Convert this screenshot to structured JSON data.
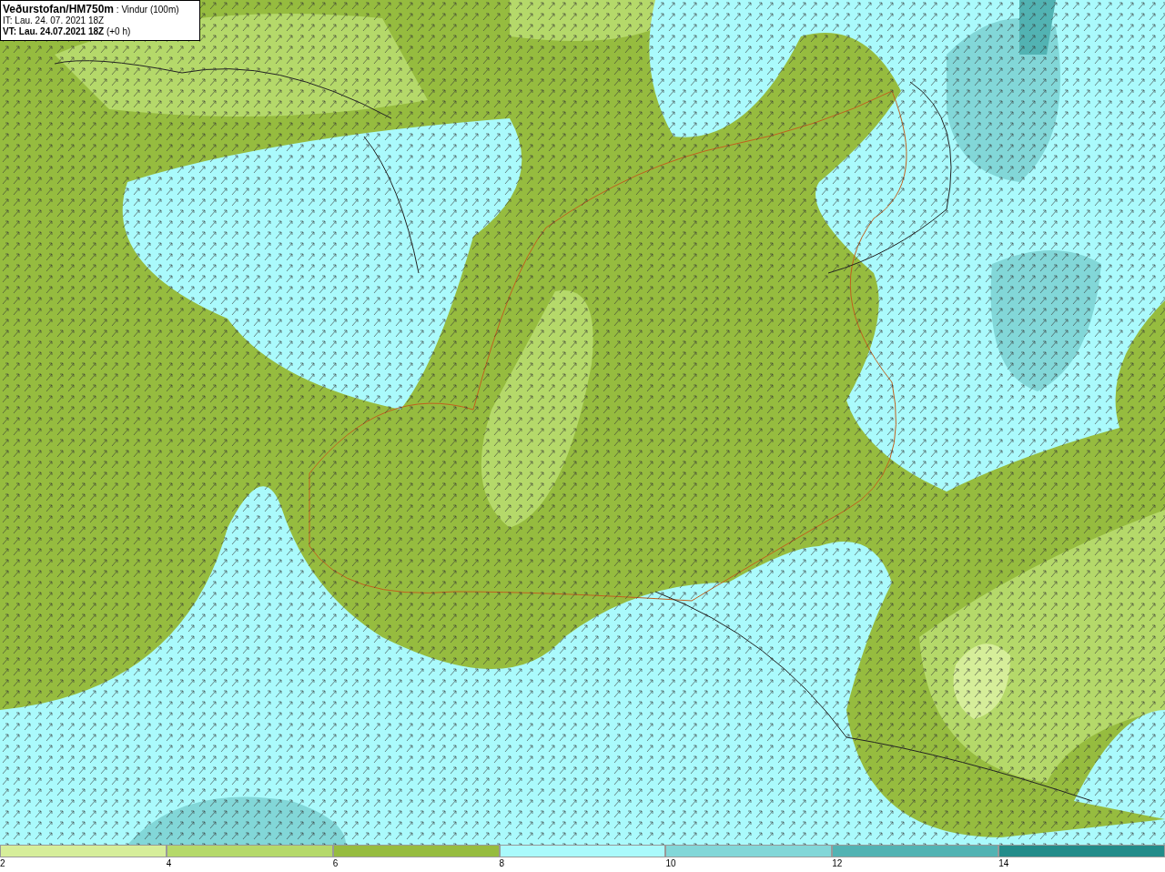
{
  "header": {
    "source": "Veðurstofan/HM750m",
    "field": ": Vindur (100m)",
    "init_time": "IT: Lau. 24. 07. 2021 18Z",
    "valid_time": "VT: Lau. 24.07.2021 18Z",
    "lead": "(+0 h)"
  },
  "legend": [
    {
      "label": "2",
      "color": "#d6ee9a"
    },
    {
      "label": "4",
      "color": "#b5d96a"
    },
    {
      "label": "6",
      "color": "#96bc3f"
    },
    {
      "label": "8",
      "color": "#aafafc"
    },
    {
      "label": "10",
      "color": "#82d7d8"
    },
    {
      "label": "12",
      "color": "#52b3b3"
    },
    {
      "label": "14",
      "color": "#238c8a"
    }
  ]
}
